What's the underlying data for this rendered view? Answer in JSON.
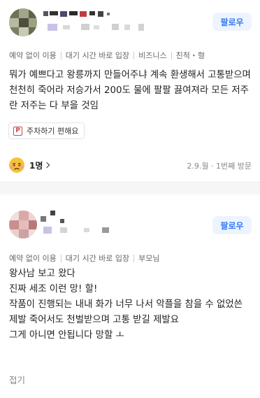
{
  "colors": {
    "accent": "#3478f6",
    "follow_bg": "#eef4ff",
    "divider_bg": "#f6f6f6",
    "muted_text": "#888888",
    "parking_icon": "#c84a4a"
  },
  "reviews": [
    {
      "author_name": "",
      "follow_label": "팔로우",
      "tags": [
        "예약 없이 이용",
        "대기 시간 바로 입장",
        "비즈니스",
        "친척・형"
      ],
      "text": "뭐가 예쁘다고 왕릉까지 만들어주냐 계속 환생해서 고통받으며 천천히 죽어라 저승가서 200도 물에 팔팔 끓여져라 모든 저주란 저주는 다 부을 것임",
      "keyword": {
        "icon": "parking-icon",
        "label": "주차하기 편해요"
      },
      "reaction": {
        "icon": "disappointed-face-icon",
        "count": "1명"
      },
      "visit": "2.9.월 · 1번째 방문"
    },
    {
      "author_name": "",
      "follow_label": "팔로우",
      "tags": [
        "예약 없이 이용",
        "대기 시간 바로 입장",
        "부모님"
      ],
      "text": "왕사남 보고 왔다\n진짜 세조 이런 망! 할!\n작품이 진행되는 내내 화가 너무 나서 악플을 참을 수 없었쓴\n제발 죽어서도 천벌받으며 고통 받길 제발요\n그게 아니면 안됩니다 망할 ㅗ",
      "fold_label": "접기"
    }
  ]
}
